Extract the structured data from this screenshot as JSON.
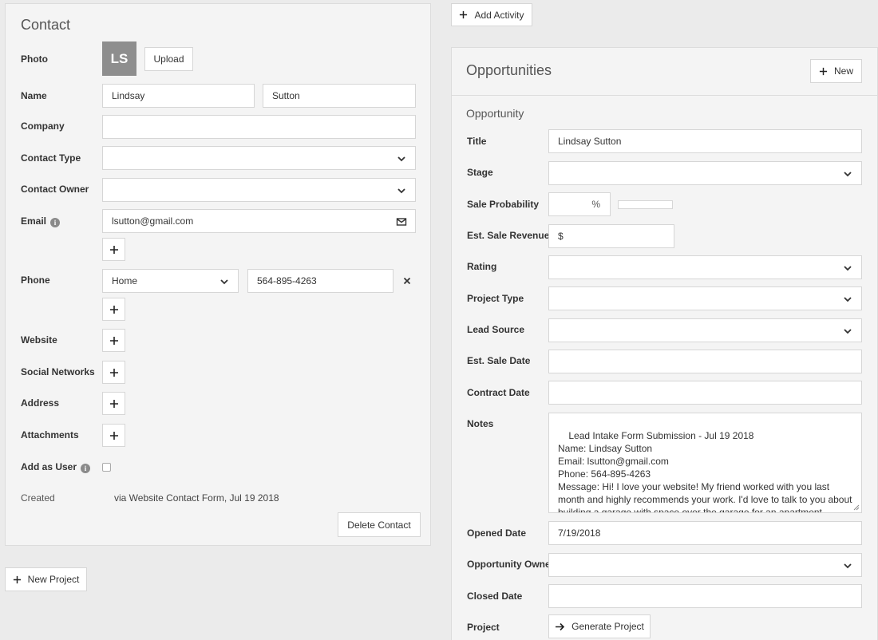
{
  "contact": {
    "title": "Contact",
    "photo": {
      "label": "Photo",
      "initials": "LS",
      "upload_label": "Upload"
    },
    "name": {
      "label": "Name",
      "first": "Lindsay",
      "last": "Sutton"
    },
    "company": {
      "label": "Company",
      "value": ""
    },
    "contact_type": {
      "label": "Contact Type",
      "value": ""
    },
    "contact_owner": {
      "label": "Contact Owner",
      "value": ""
    },
    "email": {
      "label": "Email",
      "value": "lsutton@gmail.com"
    },
    "phone": {
      "label": "Phone",
      "type": "Home",
      "value": "564-895-4263"
    },
    "website": {
      "label": "Website"
    },
    "social_networks": {
      "label": "Social Networks"
    },
    "address": {
      "label": "Address"
    },
    "attachments": {
      "label": "Attachments"
    },
    "add_as_user": {
      "label": "Add as User",
      "checked": false
    },
    "created": {
      "label": "Created",
      "value": "via Website Contact Form, Jul 19 2018"
    },
    "delete_label": "Delete Contact"
  },
  "new_project_label": "New Project",
  "add_activity_label": "Add Activity",
  "opportunities": {
    "title": "Opportunities",
    "new_label": "New",
    "section_title": "Opportunity",
    "title_field": {
      "label": "Title",
      "value": "Lindsay Sutton"
    },
    "stage": {
      "label": "Stage",
      "value": ""
    },
    "sale_probability": {
      "label": "Sale Probability",
      "unit": "%",
      "value": "",
      "fill_fraction": 0
    },
    "est_sale_revenue": {
      "label": "Est. Sale Revenue",
      "prefix": "$",
      "value": ""
    },
    "rating": {
      "label": "Rating",
      "value": ""
    },
    "project_type": {
      "label": "Project Type",
      "value": ""
    },
    "lead_source": {
      "label": "Lead Source",
      "value": ""
    },
    "est_sale_date": {
      "label": "Est. Sale Date",
      "value": ""
    },
    "contract_date": {
      "label": "Contract Date",
      "value": ""
    },
    "notes": {
      "label": "Notes",
      "value": "Lead Intake Form Submission - Jul 19 2018\nName: Lindsay Sutton\nEmail: lsutton@gmail.com\nPhone: 564-895-4263\nMessage: Hi! I love your website! My friend worked with you last month and highly recommends your work. I'd love to talk to you about building a garage with space over the garage for an apartment. Thanks!"
    },
    "opened_date": {
      "label": "Opened Date",
      "value": "7/19/2018"
    },
    "opportunity_owner": {
      "label": "Opportunity Owner",
      "value": ""
    },
    "closed_date": {
      "label": "Closed Date",
      "value": ""
    },
    "project": {
      "label": "Project",
      "generate_label": "Generate Project"
    }
  },
  "colors": {
    "background": "#ebebeb",
    "panel": "#f4f4f4",
    "avatar": "#8e8e8e",
    "border": "#d6d6d6"
  }
}
